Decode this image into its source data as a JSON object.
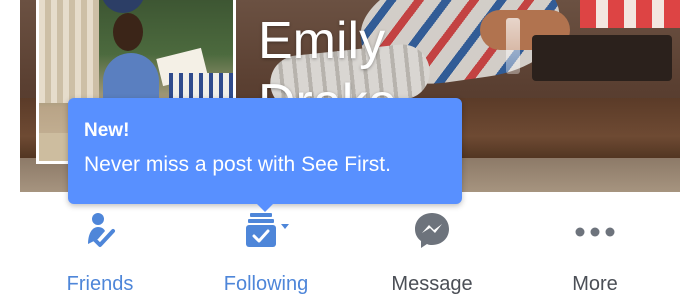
{
  "profile": {
    "name_line1": "Emily",
    "name_line2": "Drako"
  },
  "tooltip": {
    "title": "New!",
    "body": "Never miss a post with See First."
  },
  "actions": [
    {
      "label": "Friends",
      "icon": "friends-check-icon",
      "active": true
    },
    {
      "label": "Following",
      "icon": "following-inbox-icon",
      "active": true
    },
    {
      "label": "Message",
      "icon": "messenger-icon",
      "active": false
    },
    {
      "label": "More",
      "icon": "more-dots-icon",
      "active": false
    }
  ],
  "colors": {
    "accent": "#5890ff",
    "active_label": "#4e86d9",
    "inactive_label": "#4b4f56",
    "inactive_icon": "#6d737c"
  }
}
